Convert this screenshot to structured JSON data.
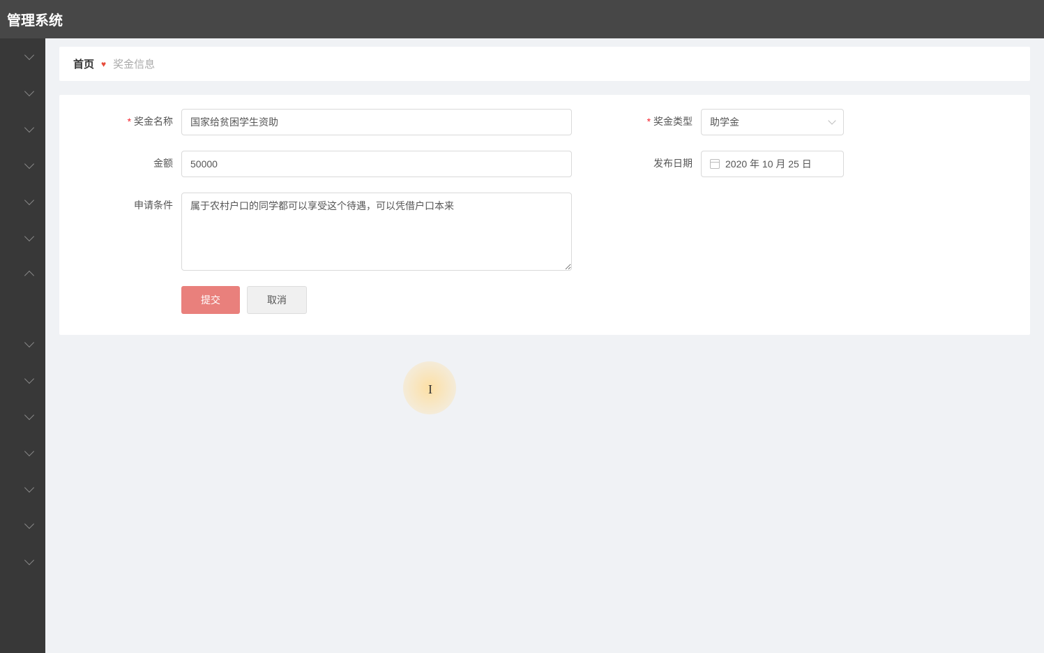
{
  "header": {
    "title": "管理系统"
  },
  "breadcrumb": {
    "home": "首页",
    "current": "奖金信息"
  },
  "form": {
    "name": {
      "label": "奖金名称",
      "value": "国家给贫困学生资助"
    },
    "type": {
      "label": "奖金类型",
      "value": "助学金"
    },
    "amount": {
      "label": "金额",
      "value": "50000"
    },
    "date": {
      "label": "发布日期",
      "value": "2020 年 10 月 25 日"
    },
    "condition": {
      "label": "申请条件",
      "value": "属于农村户口的同学都可以享受这个待遇，可以凭借户口本来"
    },
    "submit": "提交",
    "cancel": "取消"
  },
  "sidebar": {
    "items": [
      {
        "expanded": false
      },
      {
        "expanded": false
      },
      {
        "expanded": false
      },
      {
        "expanded": false
      },
      {
        "expanded": false
      },
      {
        "expanded": false
      },
      {
        "expanded": true
      },
      {
        "expanded": false
      },
      {
        "expanded": false
      },
      {
        "expanded": false
      },
      {
        "expanded": false
      },
      {
        "expanded": false
      },
      {
        "expanded": false
      },
      {
        "expanded": false
      }
    ]
  }
}
